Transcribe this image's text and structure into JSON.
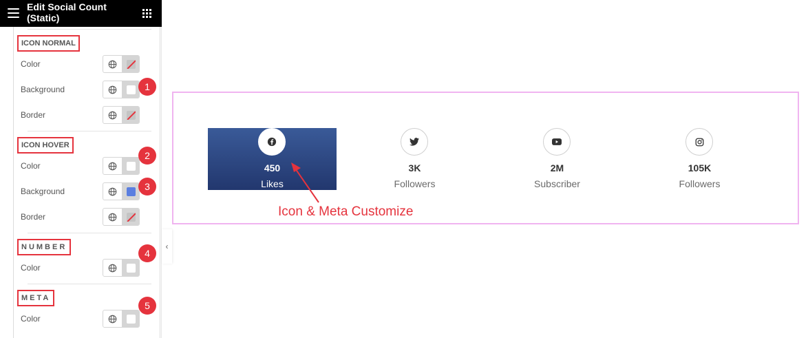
{
  "header": {
    "title": "Edit Social Count (Static)",
    "menu_icon": "hamburger-menu-icon",
    "apps_icon": "grid-apps-icon"
  },
  "sections": [
    {
      "title": "ICON NORMAL",
      "controls": [
        {
          "label": "Color",
          "swatch": "empty"
        },
        {
          "label": "Background",
          "swatch": "white",
          "badge": "1"
        },
        {
          "label": "Border",
          "swatch": "empty"
        }
      ]
    },
    {
      "title": "ICON HOVER",
      "controls": [
        {
          "label": "Color",
          "swatch": "white",
          "badge": "2"
        },
        {
          "label": "Background",
          "swatch": "blue",
          "swatch_color": "#5b7fe0",
          "badge": "3"
        },
        {
          "label": "Border",
          "swatch": "empty"
        }
      ]
    },
    {
      "title": "NUMBER",
      "controls": [
        {
          "label": "Color",
          "swatch": "white",
          "badge": "4"
        }
      ]
    },
    {
      "title": "META",
      "controls": [
        {
          "label": "Color",
          "swatch": "white",
          "badge": "5"
        }
      ]
    }
  ],
  "preview": {
    "items": [
      {
        "icon": "facebook-icon",
        "number": "450",
        "meta": "Likes",
        "active": true
      },
      {
        "icon": "twitter-icon",
        "number": "3K",
        "meta": "Followers",
        "active": false
      },
      {
        "icon": "youtube-icon",
        "number": "2M",
        "meta": "Subscriber",
        "active": false
      },
      {
        "icon": "instagram-icon",
        "number": "105K",
        "meta": "Followers",
        "active": false
      }
    ],
    "annotation": "Icon & Meta Customize"
  },
  "colors": {
    "accent_red": "#e5333d",
    "active_bg": "#2c4580",
    "hover_blue": "#5b7fe0",
    "preview_border": "#f0b4f0"
  }
}
